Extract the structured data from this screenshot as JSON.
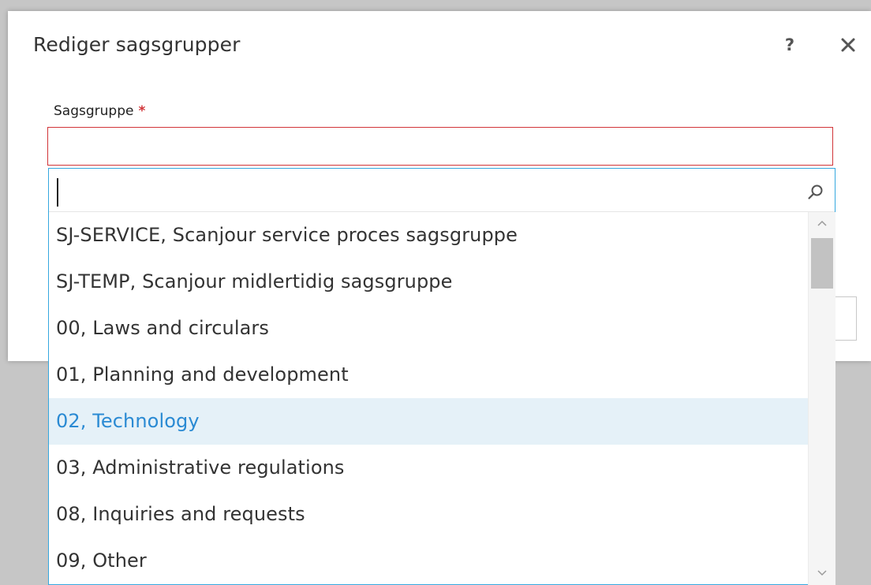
{
  "dialog": {
    "title": "Rediger sagsgrupper",
    "help_label": "?",
    "close_icon": "close-icon"
  },
  "field": {
    "label": "Sagsgruppe",
    "required_mark": "*",
    "value": ""
  },
  "dropdown": {
    "search_value": "",
    "search_icon": "search-icon",
    "items": [
      {
        "label": "SJ-SERVICE, Scanjour service proces sagsgruppe",
        "highlighted": false
      },
      {
        "label": "SJ-TEMP, Scanjour midlertidig sagsgruppe",
        "highlighted": false
      },
      {
        "label": "00, Laws and circulars",
        "highlighted": false
      },
      {
        "label": "01, Planning and development",
        "highlighted": false
      },
      {
        "label": "02, Technology",
        "highlighted": true
      },
      {
        "label": "03, Administrative regulations",
        "highlighted": false
      },
      {
        "label": "08, Inquiries and requests",
        "highlighted": false
      },
      {
        "label": "09, Other",
        "highlighted": false
      }
    ]
  },
  "colors": {
    "required": "#d13438",
    "focus_border": "#35a8df",
    "highlight_bg": "#e5f1f8",
    "highlight_text": "#2a8ad3"
  }
}
